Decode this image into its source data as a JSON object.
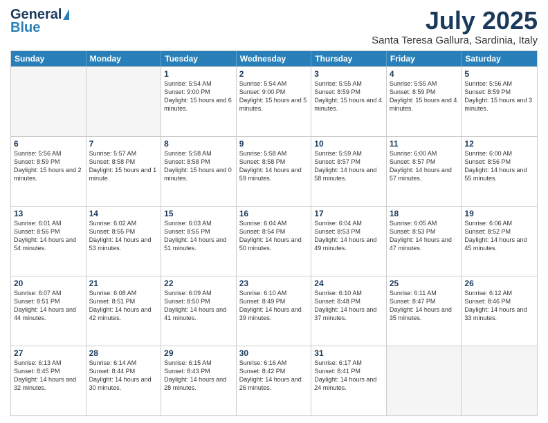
{
  "header": {
    "logo_general": "General",
    "logo_blue": "Blue",
    "month_title": "July 2025",
    "location": "Santa Teresa Gallura, Sardinia, Italy"
  },
  "weekdays": [
    "Sunday",
    "Monday",
    "Tuesday",
    "Wednesday",
    "Thursday",
    "Friday",
    "Saturday"
  ],
  "weeks": [
    [
      {
        "day": "",
        "empty": true
      },
      {
        "day": "",
        "empty": true
      },
      {
        "day": "1",
        "sunrise": "5:54 AM",
        "sunset": "9:00 PM",
        "daylight": "15 hours and 6 minutes."
      },
      {
        "day": "2",
        "sunrise": "5:54 AM",
        "sunset": "9:00 PM",
        "daylight": "15 hours and 5 minutes."
      },
      {
        "day": "3",
        "sunrise": "5:55 AM",
        "sunset": "8:59 PM",
        "daylight": "15 hours and 4 minutes."
      },
      {
        "day": "4",
        "sunrise": "5:55 AM",
        "sunset": "8:59 PM",
        "daylight": "15 hours and 4 minutes."
      },
      {
        "day": "5",
        "sunrise": "5:56 AM",
        "sunset": "8:59 PM",
        "daylight": "15 hours and 3 minutes."
      }
    ],
    [
      {
        "day": "6",
        "sunrise": "5:56 AM",
        "sunset": "8:59 PM",
        "daylight": "15 hours and 2 minutes."
      },
      {
        "day": "7",
        "sunrise": "5:57 AM",
        "sunset": "8:58 PM",
        "daylight": "15 hours and 1 minute."
      },
      {
        "day": "8",
        "sunrise": "5:58 AM",
        "sunset": "8:58 PM",
        "daylight": "15 hours and 0 minutes."
      },
      {
        "day": "9",
        "sunrise": "5:58 AM",
        "sunset": "8:58 PM",
        "daylight": "14 hours and 59 minutes."
      },
      {
        "day": "10",
        "sunrise": "5:59 AM",
        "sunset": "8:57 PM",
        "daylight": "14 hours and 58 minutes."
      },
      {
        "day": "11",
        "sunrise": "6:00 AM",
        "sunset": "8:57 PM",
        "daylight": "14 hours and 57 minutes."
      },
      {
        "day": "12",
        "sunrise": "6:00 AM",
        "sunset": "8:56 PM",
        "daylight": "14 hours and 55 minutes."
      }
    ],
    [
      {
        "day": "13",
        "sunrise": "6:01 AM",
        "sunset": "8:56 PM",
        "daylight": "14 hours and 54 minutes."
      },
      {
        "day": "14",
        "sunrise": "6:02 AM",
        "sunset": "8:55 PM",
        "daylight": "14 hours and 53 minutes."
      },
      {
        "day": "15",
        "sunrise": "6:03 AM",
        "sunset": "8:55 PM",
        "daylight": "14 hours and 51 minutes."
      },
      {
        "day": "16",
        "sunrise": "6:04 AM",
        "sunset": "8:54 PM",
        "daylight": "14 hours and 50 minutes."
      },
      {
        "day": "17",
        "sunrise": "6:04 AM",
        "sunset": "8:53 PM",
        "daylight": "14 hours and 49 minutes."
      },
      {
        "day": "18",
        "sunrise": "6:05 AM",
        "sunset": "8:53 PM",
        "daylight": "14 hours and 47 minutes."
      },
      {
        "day": "19",
        "sunrise": "6:06 AM",
        "sunset": "8:52 PM",
        "daylight": "14 hours and 45 minutes."
      }
    ],
    [
      {
        "day": "20",
        "sunrise": "6:07 AM",
        "sunset": "8:51 PM",
        "daylight": "14 hours and 44 minutes."
      },
      {
        "day": "21",
        "sunrise": "6:08 AM",
        "sunset": "8:51 PM",
        "daylight": "14 hours and 42 minutes."
      },
      {
        "day": "22",
        "sunrise": "6:09 AM",
        "sunset": "8:50 PM",
        "daylight": "14 hours and 41 minutes."
      },
      {
        "day": "23",
        "sunrise": "6:10 AM",
        "sunset": "8:49 PM",
        "daylight": "14 hours and 39 minutes."
      },
      {
        "day": "24",
        "sunrise": "6:10 AM",
        "sunset": "8:48 PM",
        "daylight": "14 hours and 37 minutes."
      },
      {
        "day": "25",
        "sunrise": "6:11 AM",
        "sunset": "8:47 PM",
        "daylight": "14 hours and 35 minutes."
      },
      {
        "day": "26",
        "sunrise": "6:12 AM",
        "sunset": "8:46 PM",
        "daylight": "14 hours and 33 minutes."
      }
    ],
    [
      {
        "day": "27",
        "sunrise": "6:13 AM",
        "sunset": "8:45 PM",
        "daylight": "14 hours and 32 minutes."
      },
      {
        "day": "28",
        "sunrise": "6:14 AM",
        "sunset": "8:44 PM",
        "daylight": "14 hours and 30 minutes."
      },
      {
        "day": "29",
        "sunrise": "6:15 AM",
        "sunset": "8:43 PM",
        "daylight": "14 hours and 28 minutes."
      },
      {
        "day": "30",
        "sunrise": "6:16 AM",
        "sunset": "8:42 PM",
        "daylight": "14 hours and 26 minutes."
      },
      {
        "day": "31",
        "sunrise": "6:17 AM",
        "sunset": "8:41 PM",
        "daylight": "14 hours and 24 minutes."
      },
      {
        "day": "",
        "empty": true
      },
      {
        "day": "",
        "empty": true
      }
    ]
  ],
  "labels": {
    "sunrise": "Sunrise:",
    "sunset": "Sunset:",
    "daylight": "Daylight:"
  }
}
